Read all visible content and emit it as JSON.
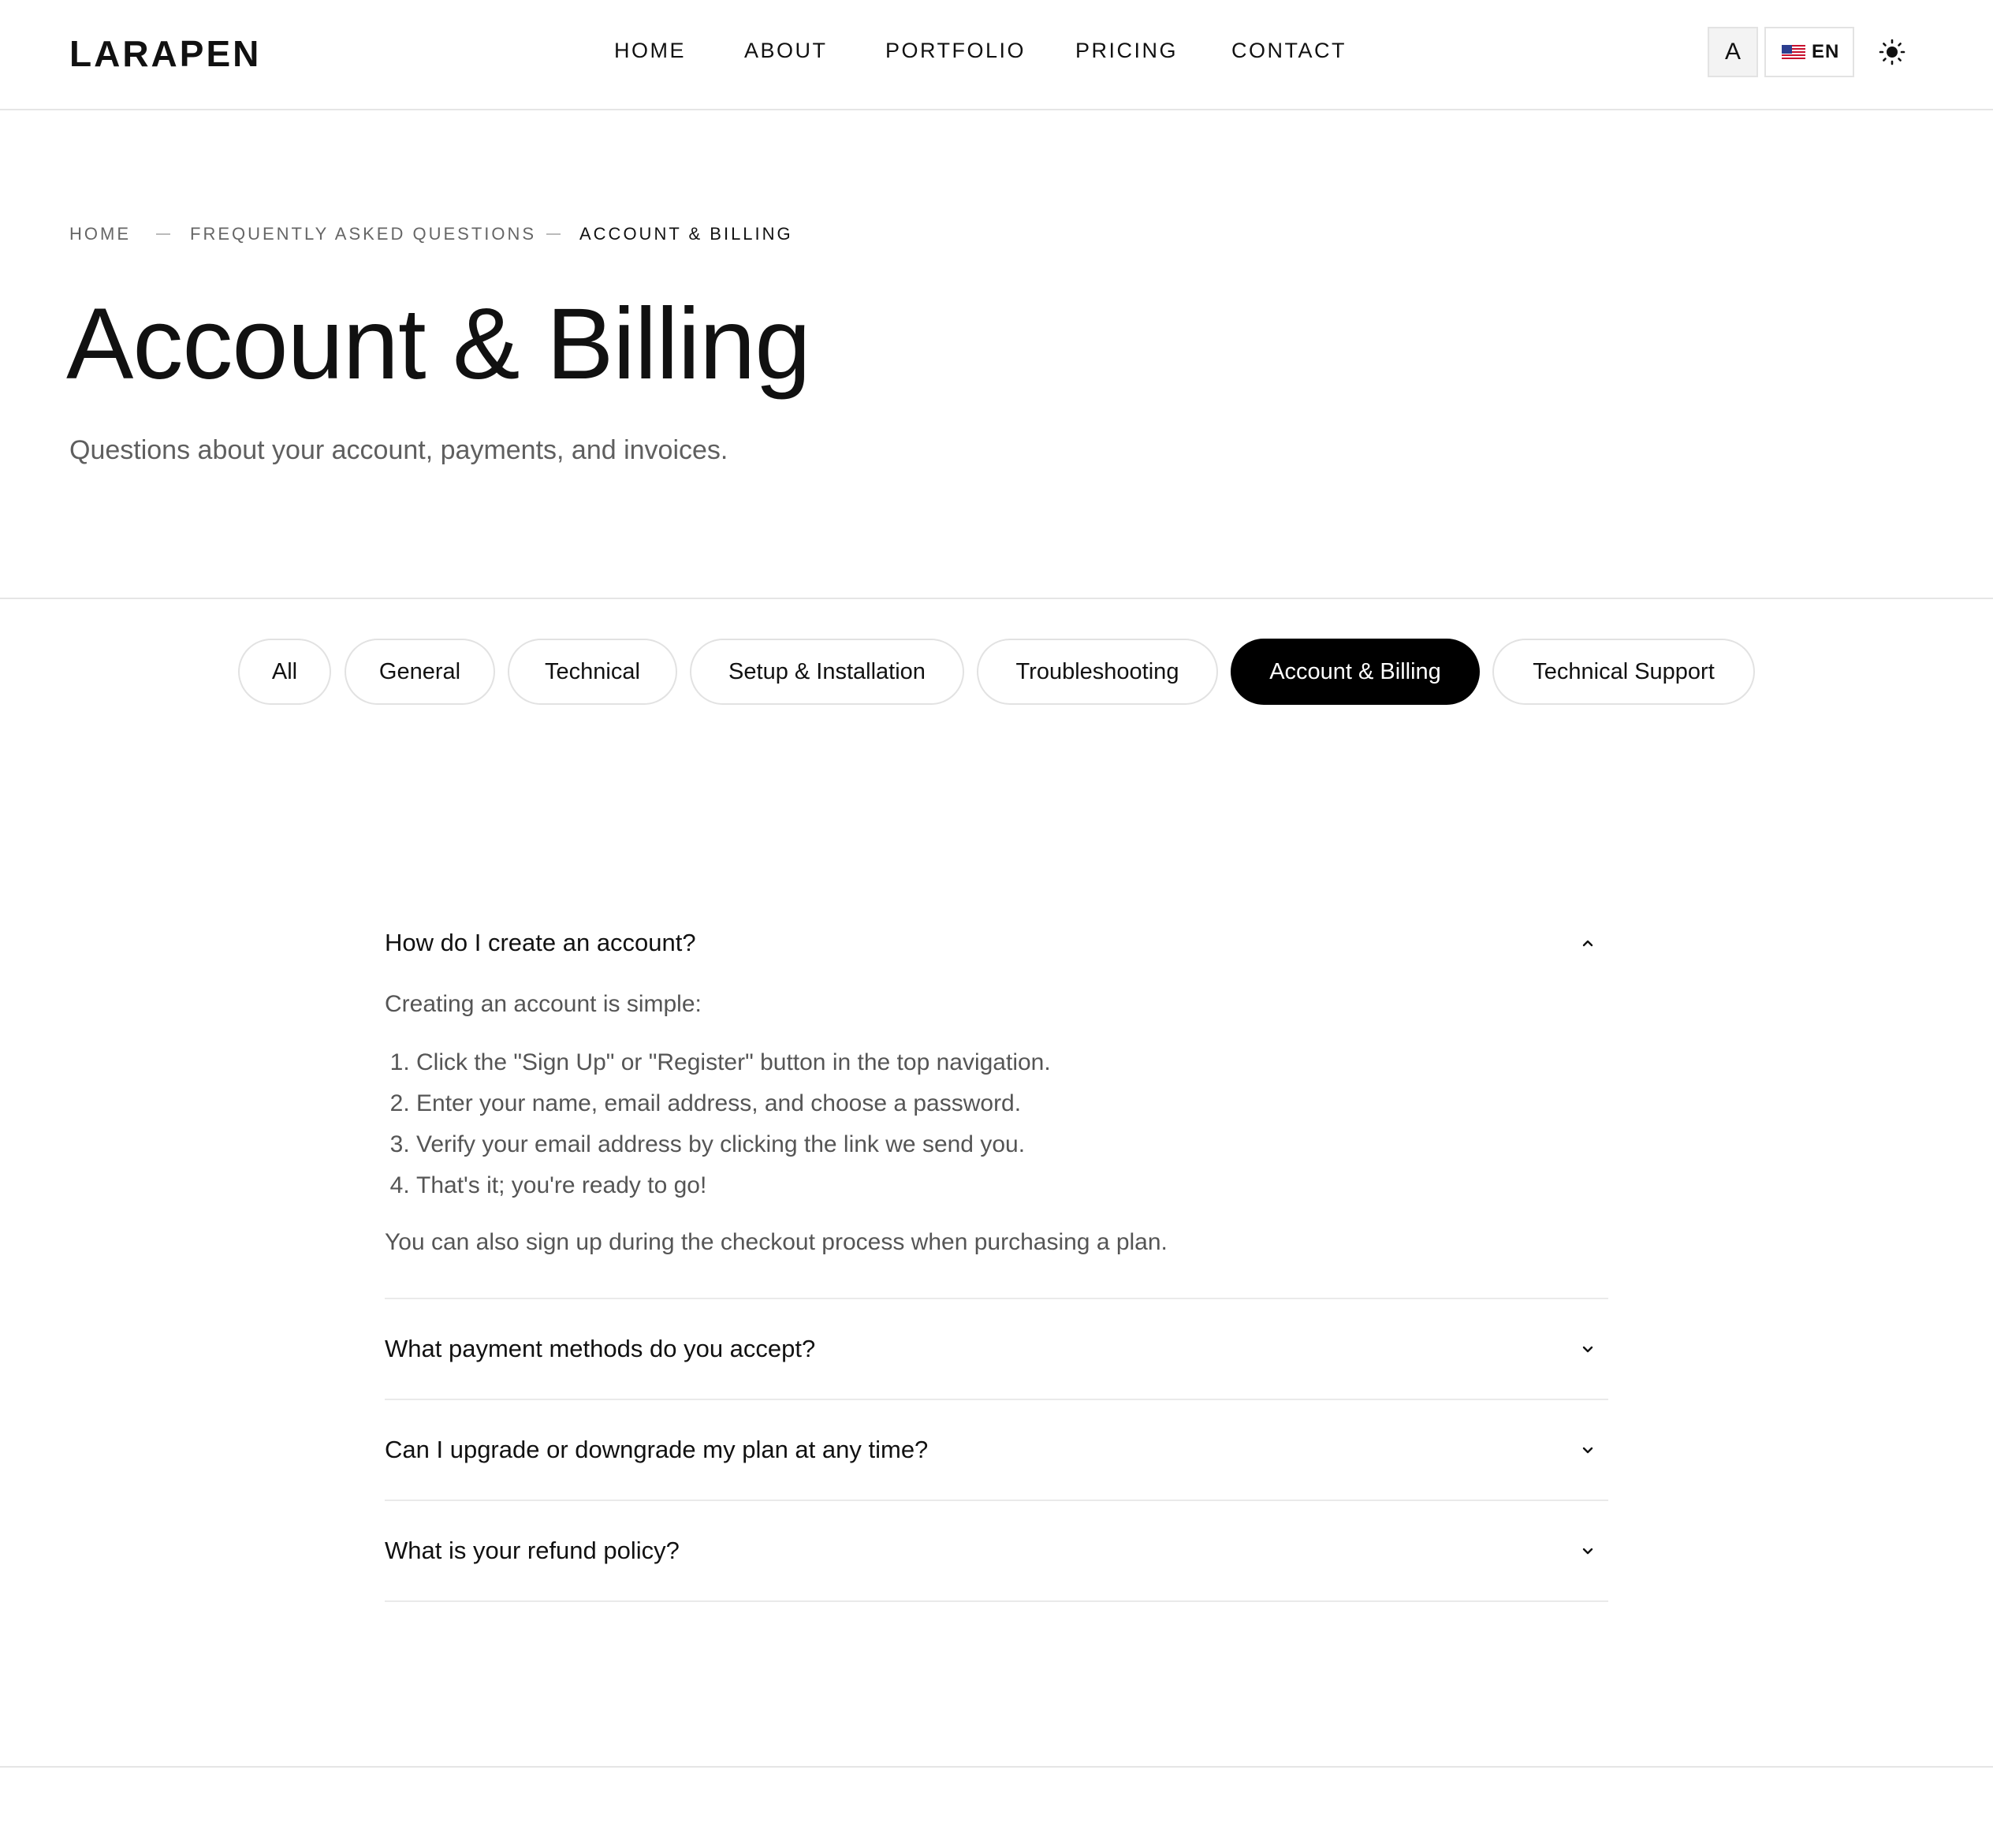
{
  "header": {
    "logo": "LARAPEN",
    "nav": [
      "HOME",
      "ABOUT",
      "PORTFOLIO",
      "PRICING",
      "CONTACT"
    ],
    "font_button": "A",
    "language": "EN",
    "flag_icon": "us-flag-icon",
    "theme_icon": "sun-icon"
  },
  "breadcrumb": {
    "items": [
      "HOME",
      "FREQUENTLY ASKED QUESTIONS",
      "ACCOUNT & BILLING"
    ]
  },
  "hero": {
    "title": "Account & Billing",
    "subtitle": "Questions about your account, payments, and invoices."
  },
  "filters": {
    "items": [
      "All",
      "General",
      "Technical",
      "Setup & Installation",
      "Troubleshooting",
      "Account & Billing",
      "Technical Support"
    ],
    "active": "Account & Billing"
  },
  "faq": [
    {
      "question": "How do I create an account?",
      "expanded": true,
      "answer": {
        "intro": "Creating an account is simple:",
        "steps": [
          "Click the \"Sign Up\" or \"Register\" button in the top navigation.",
          "Enter your name, email address, and choose a password.",
          "Verify your email address by clicking the link we send you.",
          "That's it; you're ready to go!"
        ],
        "outro": "You can also sign up during the checkout process when purchasing a plan."
      }
    },
    {
      "question": "What payment methods do you accept?",
      "expanded": false
    },
    {
      "question": "Can I upgrade or downgrade my plan at any time?",
      "expanded": false
    },
    {
      "question": "What is your refund policy?",
      "expanded": false
    }
  ],
  "colors": {
    "text": "#111111",
    "muted": "#5f5f5f",
    "border": "#e5e5e5",
    "active_pill": "#000000"
  }
}
